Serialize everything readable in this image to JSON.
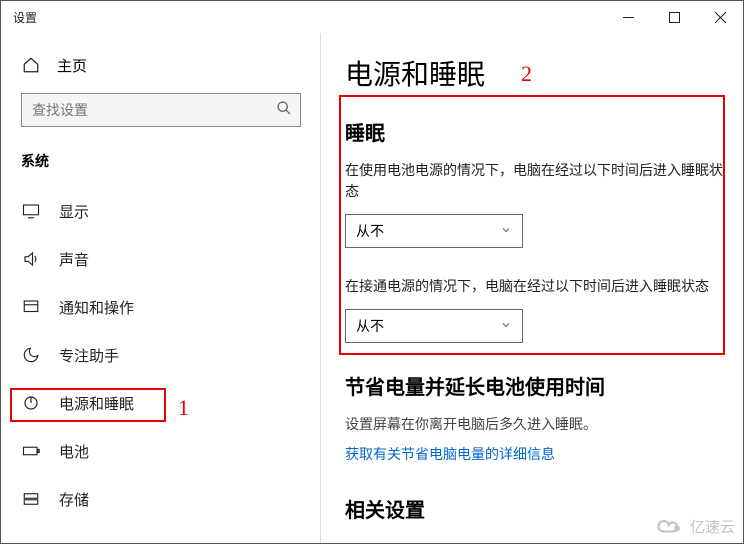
{
  "window": {
    "title": "设置"
  },
  "sidebar": {
    "home": "主页",
    "search_placeholder": "查找设置",
    "group": "系统",
    "items": [
      {
        "icon": "display",
        "label": "显示"
      },
      {
        "icon": "sound",
        "label": "声音"
      },
      {
        "icon": "notify",
        "label": "通知和操作"
      },
      {
        "icon": "focus",
        "label": "专注助手"
      },
      {
        "icon": "power",
        "label": "电源和睡眠"
      },
      {
        "icon": "battery",
        "label": "电池"
      },
      {
        "icon": "storage",
        "label": "存储"
      }
    ]
  },
  "main": {
    "title": "电源和睡眠",
    "sleep": {
      "heading": "睡眠",
      "battery_desc": "在使用电池电源的情况下，电脑在经过以下时间后进入睡眠状态",
      "battery_value": "从不",
      "plugged_desc": "在接通电源的情况下，电脑在经过以下时间后进入睡眠状态",
      "plugged_value": "从不"
    },
    "save_power": {
      "heading": "节省电量并延长电池使用时间",
      "sub": "设置屏幕在你离开电脑后多久进入睡眠。",
      "link": "获取有关节省电脑电量的详细信息"
    },
    "related": {
      "heading": "相关设置"
    }
  },
  "annotations": {
    "num1": "1",
    "num2": "2"
  },
  "watermark": "亿速云"
}
